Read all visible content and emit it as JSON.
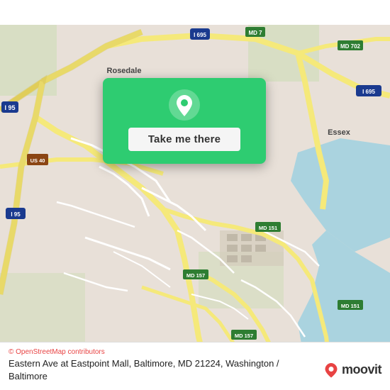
{
  "map": {
    "attribution": "© OpenStreetMap contributors",
    "attribution_symbol": "©",
    "bg_color": "#e8e0d8",
    "road_color_major": "#f5e97a",
    "road_color_highway": "#f5e97a",
    "road_color_minor": "#ffffff",
    "water_color": "#aad3df"
  },
  "popup": {
    "background_color": "#2ecc71",
    "button_label": "Take me there"
  },
  "bottom_bar": {
    "osm_credit": "© OpenStreetMap contributors",
    "location_text": "Eastern Ave at Eastpoint Mall, Baltimore, MD 21224, Washington / Baltimore",
    "moovit_label": "moovit"
  },
  "icons": {
    "map_pin": "📍",
    "moovit_pin_color": "#e84343"
  }
}
